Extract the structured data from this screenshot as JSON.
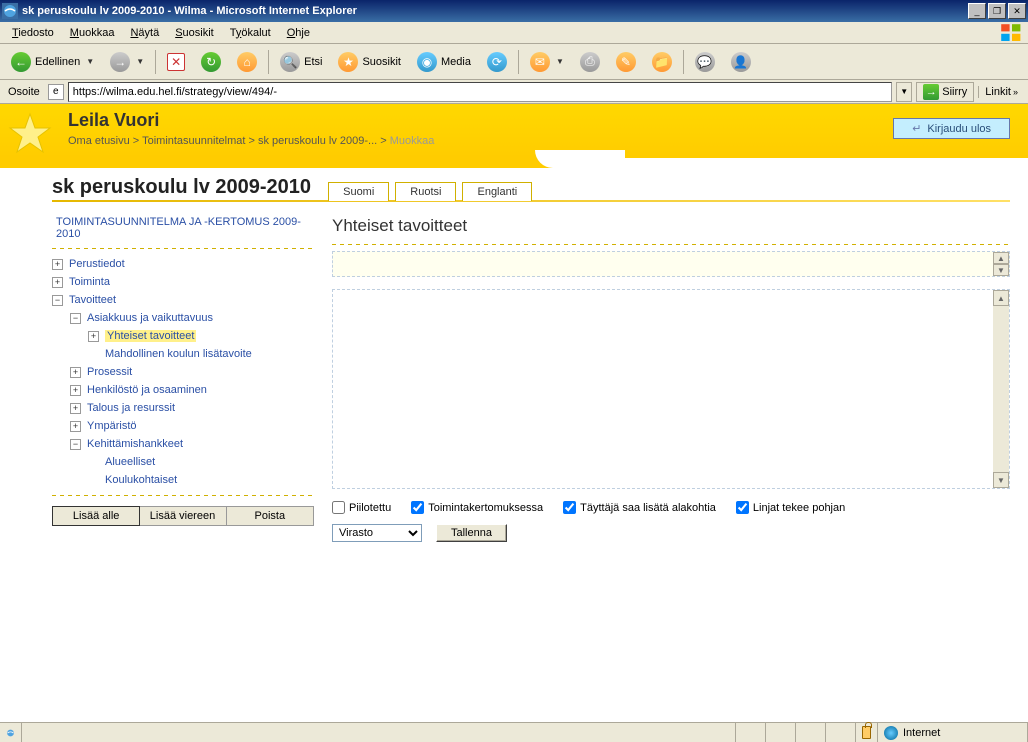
{
  "window": {
    "title": "sk peruskoulu lv 2009-2010 - Wilma - Microsoft Internet Explorer"
  },
  "menubar": {
    "items": [
      "Tiedosto",
      "Muokkaa",
      "Näytä",
      "Suosikit",
      "Työkalut",
      "Ohje"
    ]
  },
  "toolbar": {
    "back": "Edellinen",
    "search": "Etsi",
    "favorites": "Suosikit",
    "media": "Media"
  },
  "addressbar": {
    "label": "Osoite",
    "url": "https://wilma.edu.hel.fi/strategy/view/494/-",
    "go": "Siirry",
    "links": "Linkit"
  },
  "header": {
    "user": "Leila Vuori",
    "breadcrumb": {
      "home": "Oma etusivu",
      "plans": "Toimintasuunnitelmat",
      "plan": "sk peruskoulu lv 2009-...",
      "current": "Muokkaa"
    },
    "logout": "Kirjaudu ulos"
  },
  "page_title": "sk peruskoulu lv 2009-2010",
  "tabs": {
    "fi": "Suomi",
    "sv": "Ruotsi",
    "en": "Englanti"
  },
  "sidebar": {
    "title": "TOIMINTASUUNNITELMA JA -KERTOMUS 2009-2010",
    "perustiedot": "Perustiedot",
    "toiminta": "Toiminta",
    "tavoitteet": "Tavoitteet",
    "asiakkuus": "Asiakkuus ja vaikuttavuus",
    "yhteiset": "Yhteiset tavoitteet",
    "mahdollinen": "Mahdollinen koulun lisätavoite",
    "prosessit": "Prosessit",
    "henkilosto": "Henkilöstö ja osaaminen",
    "talous": "Talous ja resurssit",
    "ymparisto": "Ympäristö",
    "kehittamis": "Kehittämishankkeet",
    "alueelliset": "Alueelliset",
    "koulukohtaiset": "Koulukohtaiset",
    "btn_under": "Lisää alle",
    "btn_beside": "Lisää viereen",
    "btn_delete": "Poista"
  },
  "editor": {
    "section_title": "Yhteiset tavoitteet",
    "cb_hidden": "Piilotettu",
    "cb_report": "Toimintakertomuksessa",
    "cb_subitems": "Täyttäjä saa lisätä alakohtia",
    "cb_template": "Linjat tekee pohjan",
    "level_options": [
      "Virasto"
    ],
    "level_selected": "Virasto",
    "save": "Tallenna"
  },
  "statusbar": {
    "zone": "Internet"
  }
}
